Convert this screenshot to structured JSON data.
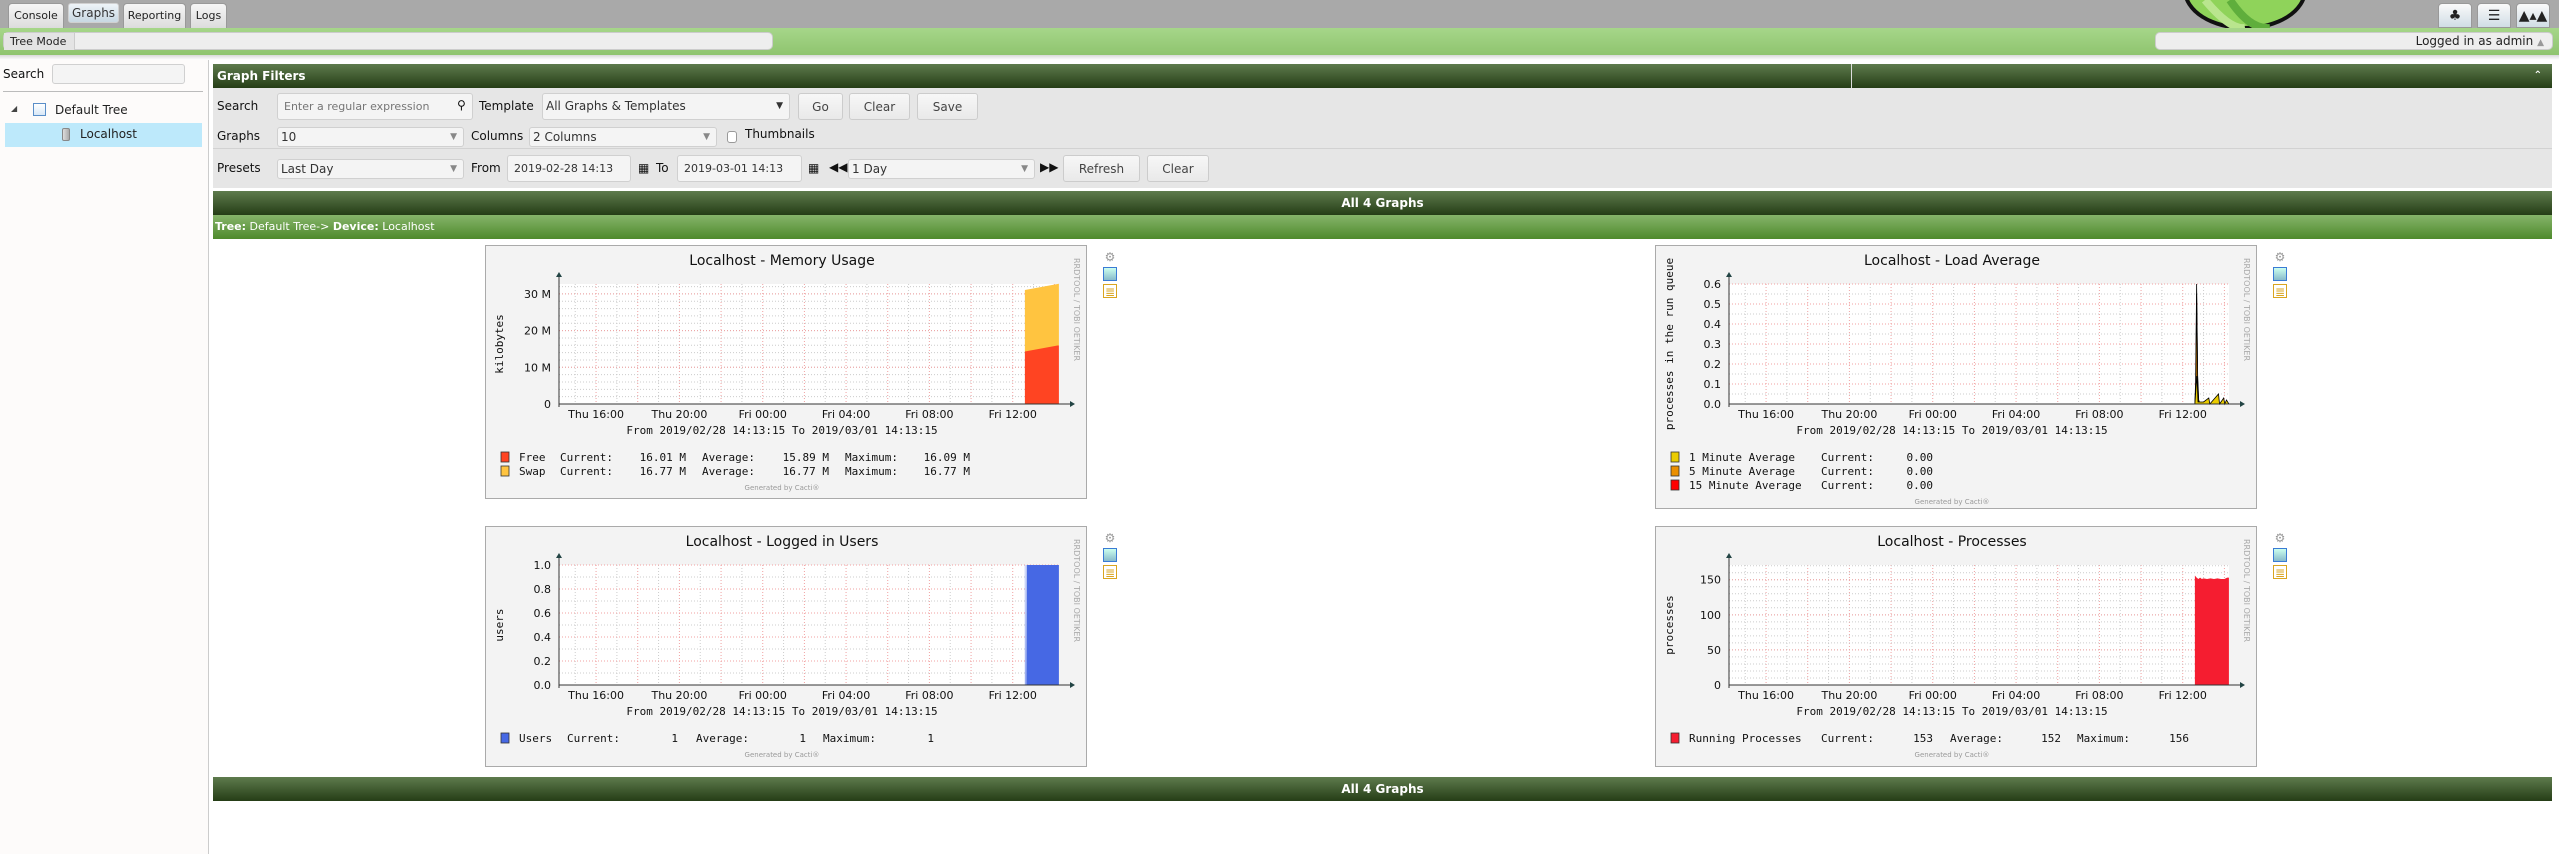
{
  "nav": {
    "tabs": [
      {
        "label": "Console",
        "selected": false
      },
      {
        "label": "Graphs",
        "selected": true
      },
      {
        "label": "Reporting",
        "selected": false
      },
      {
        "label": "Logs",
        "selected": false
      }
    ],
    "breadcrumb": "Tree Mode",
    "logged_in": "Logged in as admin",
    "view_buttons": [
      "tree-view-icon",
      "list-view-icon",
      "preview-view-icon"
    ]
  },
  "sidebar": {
    "search_label": "Search",
    "search_value": "",
    "tree": [
      {
        "label": "Default Tree",
        "icon": "tree-icon",
        "expanded": true
      },
      {
        "label": "Localhost",
        "icon": "server-icon",
        "selected": true
      }
    ]
  },
  "filters": {
    "title": "Graph Filters",
    "search_label": "Search",
    "search_placeholder": "Enter a regular expression",
    "template_label": "Template",
    "template_value": "All Graphs & Templates",
    "go": "Go",
    "clear": "Clear",
    "save": "Save",
    "graphs_label": "Graphs",
    "graphs_value": "10",
    "columns_label": "Columns",
    "columns_value": "2 Columns",
    "thumbnails_label": "Thumbnails",
    "thumbnails_checked": false,
    "presets_label": "Presets",
    "presets_value": "Last Day",
    "from_label": "From",
    "from_value": "2019-02-28 14:13",
    "to_label": "To",
    "to_value": "2019-03-01 14:13",
    "timespan_value": "1 Day",
    "refresh": "Refresh",
    "clear2": "Clear"
  },
  "section": {
    "all_graphs": "All 4 Graphs",
    "tree_prefix": "Tree:",
    "tree_name": "Default Tree->",
    "device_prefix": "Device:",
    "device_name": "Localhost",
    "all_graphs_bottom": "All 4 Graphs"
  },
  "chart_data": [
    {
      "type": "area",
      "title": "Localhost - Memory Usage",
      "ylabel": "kilobytes",
      "ylim": [
        0,
        32700000
      ],
      "yticks": [
        {
          "v": 0,
          "label": "0"
        },
        {
          "v": 10000000,
          "label": "10 M"
        },
        {
          "v": 20000000,
          "label": "20 M"
        },
        {
          "v": 30000000,
          "label": "30 M"
        }
      ],
      "xlim": [
        "2019-02-28 14:13:15",
        "2019-03-01 14:13:15"
      ],
      "xticks": [
        "Thu 16:00",
        "Thu 20:00",
        "Fri 00:00",
        "Fri 04:00",
        "Fri 08:00",
        "Fri 12:00"
      ],
      "range_text": "From 2019/02/28 14:13:15 To 2019/03/01 14:13:15",
      "watermark": "RRDTOOL / TOBI OETIKER",
      "footer": "Generated by Cacti®",
      "stacked": true,
      "grid": true,
      "series": [
        {
          "name": "Free",
          "color": "#FF4422",
          "points": [
            [
              "2019-03-01 12:35",
              14300000
            ],
            [
              "2019-03-01 12:38",
              15900000
            ],
            [
              "2019-03-01 13:20",
              16000000
            ],
            [
              "2019-03-01 14:13",
              16010000
            ]
          ],
          "legend": {
            "current": "16.01 M",
            "average": "15.89 M",
            "maximum": "16.09 M"
          }
        },
        {
          "name": "Swap",
          "color": "#FFC440",
          "points": [
            [
              "2019-03-01 12:35",
              16770000
            ],
            [
              "2019-03-01 14:13",
              16770000
            ]
          ],
          "legend": {
            "current": "16.77 M",
            "average": "16.77 M",
            "maximum": "16.77 M"
          }
        }
      ]
    },
    {
      "type": "area",
      "title": "Localhost - Load Average",
      "ylabel": "processes in the run queue",
      "ylim": [
        0,
        0.6
      ],
      "yticks": [
        {
          "v": 0,
          "label": "0.0"
        },
        {
          "v": 0.1,
          "label": "0.1"
        },
        {
          "v": 0.2,
          "label": "0.2"
        },
        {
          "v": 0.3,
          "label": "0.3"
        },
        {
          "v": 0.4,
          "label": "0.4"
        },
        {
          "v": 0.5,
          "label": "0.5"
        },
        {
          "v": 0.6,
          "label": "0.6"
        }
      ],
      "xlim": [
        "2019-02-28 14:13:15",
        "2019-03-01 14:13:15"
      ],
      "xticks": [
        "Thu 16:00",
        "Thu 20:00",
        "Fri 00:00",
        "Fri 04:00",
        "Fri 08:00",
        "Fri 12:00"
      ],
      "range_text": "From 2019/02/28 14:13:15 To 2019/03/01 14:13:15",
      "watermark": "RRDTOOL / TOBI OETIKER",
      "footer": "Generated by Cacti®",
      "stacked": false,
      "grid": true,
      "series": [
        {
          "name": "15 Minute Average",
          "color": "#FF0000",
          "points": [
            [
              "2019-03-01 12:35",
              0
            ],
            [
              "2019-03-01 12:37",
              0.11
            ],
            [
              "2019-03-01 12:40",
              0.6
            ],
            [
              "2019-03-01 12:43",
              0.14
            ],
            [
              "2019-03-01 12:46",
              0.02
            ],
            [
              "2019-03-01 12:50",
              0
            ],
            [
              "2019-03-01 14:13",
              0
            ]
          ],
          "legend": {
            "current": "0.00"
          }
        },
        {
          "name": "5 Minute Average",
          "color": "#EA8F00",
          "points": [
            [
              "2019-03-01 12:35",
              0
            ],
            [
              "2019-03-01 12:38",
              0.11
            ],
            [
              "2019-03-01 12:40",
              0.55
            ],
            [
              "2019-03-01 12:43",
              0.12
            ],
            [
              "2019-03-01 12:46",
              0
            ],
            [
              "2019-03-01 13:05",
              0.01
            ],
            [
              "2019-03-01 13:10",
              0
            ],
            [
              "2019-03-01 14:13",
              0
            ]
          ],
          "legend": {
            "current": "0.00"
          }
        },
        {
          "name": "1 Minute Average",
          "color": "#EACC00",
          "points": [
            [
              "2019-03-01 12:35",
              0
            ],
            [
              "2019-03-01 12:39",
              0.1
            ],
            [
              "2019-03-01 12:41",
              0.14
            ],
            [
              "2019-03-01 12:44",
              0.01
            ],
            [
              "2019-03-01 13:00",
              0.01
            ],
            [
              "2019-03-01 13:15",
              0.03
            ],
            [
              "2019-03-01 13:18",
              0
            ],
            [
              "2019-03-01 13:43",
              0.05
            ],
            [
              "2019-03-01 13:46",
              0
            ],
            [
              "2019-03-01 13:58",
              0.03
            ],
            [
              "2019-03-01 14:01",
              0
            ],
            [
              "2019-03-01 14:06",
              0.02
            ],
            [
              "2019-03-01 14:13",
              0
            ]
          ],
          "legend": {
            "current": "0.00"
          }
        }
      ]
    },
    {
      "type": "area",
      "title": "Localhost - Logged in Users",
      "ylabel": "users",
      "ylim": [
        0,
        1.0
      ],
      "yticks": [
        {
          "v": 0,
          "label": "0.0"
        },
        {
          "v": 0.2,
          "label": "0.2"
        },
        {
          "v": 0.4,
          "label": "0.4"
        },
        {
          "v": 0.6,
          "label": "0.6"
        },
        {
          "v": 0.8,
          "label": "0.8"
        },
        {
          "v": 1.0,
          "label": "1.0"
        }
      ],
      "xlim": [
        "2019-02-28 14:13:15",
        "2019-03-01 14:13:15"
      ],
      "xticks": [
        "Thu 16:00",
        "Thu 20:00",
        "Fri 00:00",
        "Fri 04:00",
        "Fri 08:00",
        "Fri 12:00"
      ],
      "range_text": "From 2019/02/28 14:13:15 To 2019/03/01 14:13:15",
      "watermark": "RRDTOOL / TOBI OETIKER",
      "footer": "Generated by Cacti®",
      "stacked": false,
      "grid": true,
      "series": [
        {
          "name": "Users",
          "color": "#4668E4",
          "points": [
            [
              "2019-03-01 12:35",
              1
            ],
            [
              "2019-03-01 12:36",
              1
            ],
            [
              "2019-03-01 12:37",
              0
            ],
            [
              "2019-03-01 12:39",
              0
            ],
            [
              "2019-03-01 12:40",
              1
            ],
            [
              "2019-03-01 14:13",
              1
            ]
          ],
          "legend": {
            "current": "1",
            "average": "1",
            "maximum": "1"
          }
        }
      ]
    },
    {
      "type": "area",
      "title": "Localhost - Processes",
      "ylabel": "processes",
      "ylim": [
        0,
        171
      ],
      "yticks": [
        {
          "v": 0,
          "label": "0"
        },
        {
          "v": 50,
          "label": "50"
        },
        {
          "v": 100,
          "label": "100"
        },
        {
          "v": 150,
          "label": "150"
        }
      ],
      "xlim": [
        "2019-02-28 14:13:15",
        "2019-03-01 14:13:15"
      ],
      "xticks": [
        "Thu 16:00",
        "Thu 20:00",
        "Fri 00:00",
        "Fri 04:00",
        "Fri 08:00",
        "Fri 12:00"
      ],
      "range_text": "From 2019/02/28 14:13:15 To 2019/03/01 14:13:15",
      "watermark": "RRDTOOL / TOBI OETIKER",
      "footer": "Generated by Cacti®",
      "stacked": false,
      "grid": true,
      "series": [
        {
          "name": "Running Processes",
          "color": "#F51D30",
          "points": [
            [
              "2019-03-01 12:35",
              156
            ],
            [
              "2019-03-01 12:40",
              153
            ],
            [
              "2019-03-01 12:45",
              151
            ],
            [
              "2019-03-01 12:50",
              153
            ],
            [
              "2019-03-01 12:55",
              151
            ],
            [
              "2019-03-01 13:00",
              152
            ],
            [
              "2019-03-01 13:10",
              151
            ],
            [
              "2019-03-01 13:20",
              152
            ],
            [
              "2019-03-01 13:30",
              151
            ],
            [
              "2019-03-01 13:40",
              152
            ],
            [
              "2019-03-01 13:50",
              151
            ],
            [
              "2019-03-01 14:00",
              151
            ],
            [
              "2019-03-01 14:08",
              153
            ],
            [
              "2019-03-01 14:13",
              153
            ]
          ],
          "legend": {
            "current": "153",
            "average": "152",
            "maximum": "156"
          }
        }
      ]
    }
  ]
}
